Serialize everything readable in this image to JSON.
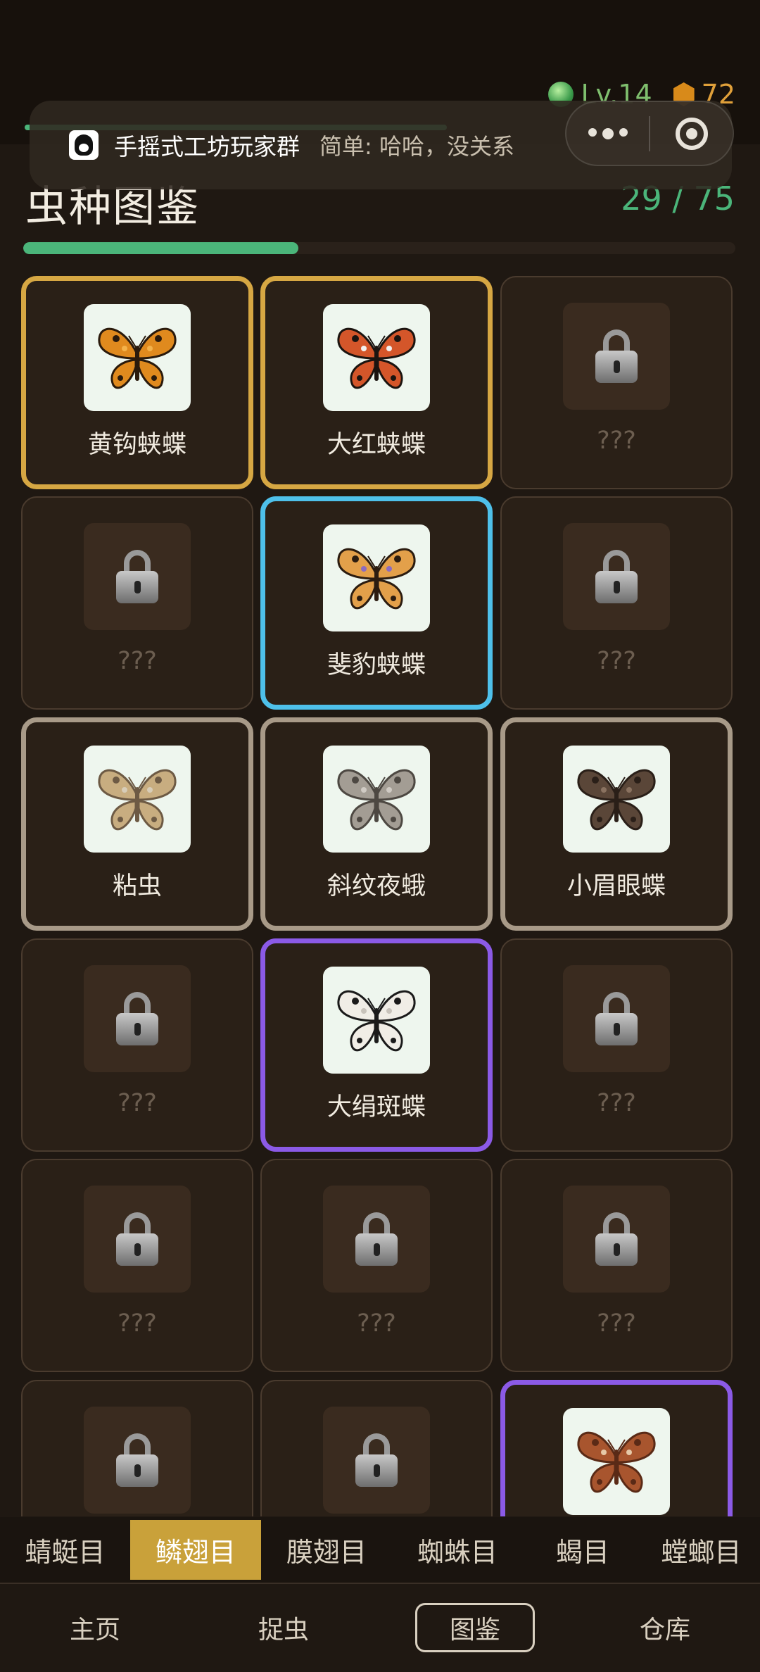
{
  "status": {
    "level": "Lv.14",
    "coins": "72"
  },
  "notice": {
    "group": "手摇式工坊玩家群",
    "message": "简单: 哈哈，没关系"
  },
  "page": {
    "title": "虫种图鉴",
    "progress_text": "29 / 75",
    "progress_fraction": 0.3867
  },
  "cards": [
    {
      "name": "黄钩蛱蝶",
      "rarity": "gold",
      "locked": false,
      "image": "orange-butterfly"
    },
    {
      "name": "大红蛱蝶",
      "rarity": "gold",
      "locked": false,
      "image": "red-admiral-butterfly"
    },
    {
      "name": "???",
      "rarity": "none",
      "locked": true,
      "image": "lock-icon"
    },
    {
      "name": "???",
      "rarity": "none",
      "locked": true,
      "image": "lock-icon"
    },
    {
      "name": "斐豹蛱蝶",
      "rarity": "blue",
      "locked": false,
      "image": "fritillary-butterfly"
    },
    {
      "name": "???",
      "rarity": "none",
      "locked": true,
      "image": "lock-icon"
    },
    {
      "name": "粘虫",
      "rarity": "gray",
      "locked": false,
      "image": "armyworm-moth"
    },
    {
      "name": "斜纹夜蛾",
      "rarity": "gray",
      "locked": false,
      "image": "cutworm-moth"
    },
    {
      "name": "小眉眼蝶",
      "rarity": "gray",
      "locked": false,
      "image": "brown-eyed-butterfly"
    },
    {
      "name": "???",
      "rarity": "none",
      "locked": true,
      "image": "lock-icon"
    },
    {
      "name": "大绢斑蝶",
      "rarity": "purple",
      "locked": false,
      "image": "chestnut-tiger-butterfly"
    },
    {
      "name": "???",
      "rarity": "none",
      "locked": true,
      "image": "lock-icon"
    },
    {
      "name": "???",
      "rarity": "none",
      "locked": true,
      "image": "lock-icon"
    },
    {
      "name": "???",
      "rarity": "none",
      "locked": true,
      "image": "lock-icon"
    },
    {
      "name": "???",
      "rarity": "none",
      "locked": true,
      "image": "lock-icon"
    },
    {
      "name": "",
      "rarity": "none",
      "locked": true,
      "image": "lock-icon"
    },
    {
      "name": "",
      "rarity": "none",
      "locked": true,
      "image": "lock-icon"
    },
    {
      "name": "",
      "rarity": "purple",
      "locked": false,
      "image": "atlas-moth"
    }
  ],
  "categories": [
    {
      "label": "蜻蜓目",
      "active": false
    },
    {
      "label": "鳞翅目",
      "active": true
    },
    {
      "label": "膜翅目",
      "active": false
    },
    {
      "label": "蜘蛛目",
      "active": false
    },
    {
      "label": "蝎目",
      "active": false
    },
    {
      "label": "螳螂目",
      "active": false
    }
  ],
  "nav": [
    {
      "label": "主页",
      "active": false
    },
    {
      "label": "捉虫",
      "active": false
    },
    {
      "label": "图鉴",
      "active": true
    },
    {
      "label": "仓库",
      "active": false
    }
  ],
  "colors": {
    "accent_green": "#4bb57a",
    "gold": "#d6a743",
    "blue": "#4ec0ea",
    "gray": "#a89a88",
    "purple": "#8b5ae6",
    "tab_active": "#c9a13a"
  }
}
